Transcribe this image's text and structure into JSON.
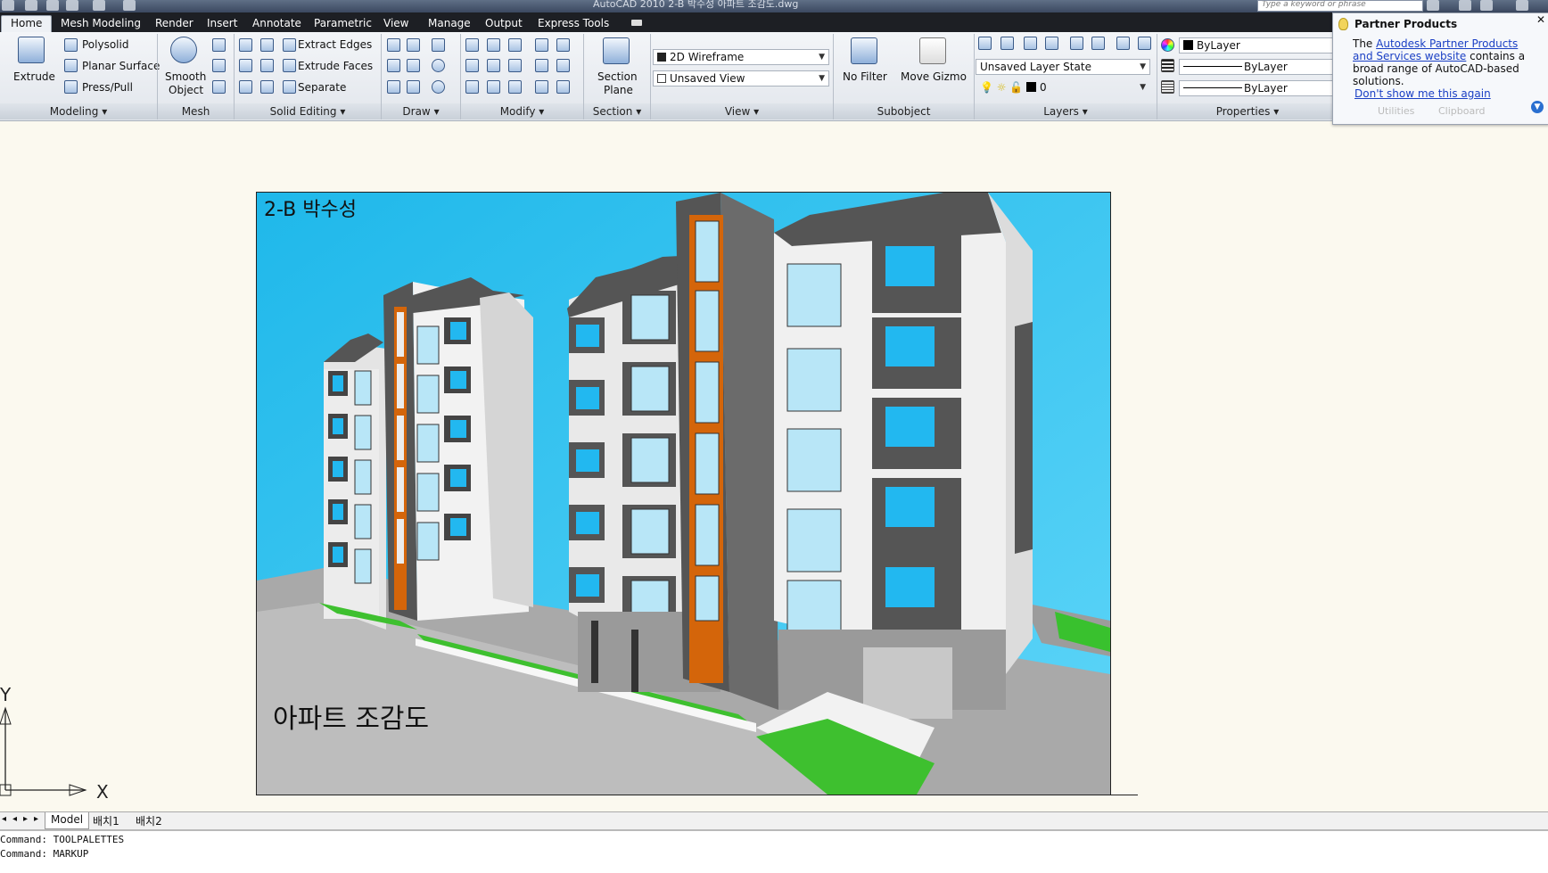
{
  "window": {
    "title": "AutoCAD 2010    2-B 박수성 아파트 조감도.dwg"
  },
  "search": {
    "placeholder": "Type a keyword or phrase"
  },
  "tabs": [
    "Home",
    "Mesh Modeling",
    "Render",
    "Insert",
    "Annotate",
    "Parametric",
    "View",
    "Manage",
    "Output",
    "Express Tools"
  ],
  "panels": {
    "modeling": {
      "title": "Modeling",
      "extrude": "Extrude",
      "polysolid": "Polysolid",
      "planar_surface": "Planar Surface",
      "press_pull": "Press/Pull"
    },
    "mesh": {
      "title": "Mesh",
      "smooth_object_1": "Smooth",
      "smooth_object_2": "Object"
    },
    "solid_editing": {
      "title": "Solid Editing",
      "extract_edges": "Extract Edges",
      "extrude_faces": "Extrude Faces",
      "separate": "Separate"
    },
    "draw": {
      "title": "Draw"
    },
    "modify": {
      "title": "Modify"
    },
    "section": {
      "title": "Section",
      "section_plane_1": "Section",
      "section_plane_2": "Plane"
    },
    "view": {
      "title": "View",
      "visual_style": "2D Wireframe",
      "named_view": "Unsaved View"
    },
    "subobject": {
      "title": "Subobject",
      "no_filter": "No Filter",
      "move_gizmo": "Move Gizmo"
    },
    "layers": {
      "title": "Layers",
      "layer_state": "Unsaved Layer State",
      "current_layer": "0"
    },
    "properties": {
      "title": "Properties",
      "color": "ByLayer",
      "linetype": "ByLayer",
      "lineweight": "ByLayer"
    },
    "hidden": {
      "utilities": "Utilities",
      "clipboard": "Clipboard"
    }
  },
  "partner_popup": {
    "title": "Partner Products",
    "text_prefix": "The ",
    "link": "Autodesk Partner Products and Services website",
    "text_suffix": " contains a broad range of AutoCAD-based solutions.",
    "dismiss": "Don't show me this again"
  },
  "drawing": {
    "label_top": "2-B 박수성",
    "label_bottom": "아파트 조감도"
  },
  "ucs": {
    "x": "X",
    "y": "Y"
  },
  "layout_tabs": [
    "Model",
    "배치1",
    "배치2"
  ],
  "command_history": [
    "Command: TOOLPALETTES",
    "Command: MARKUP"
  ],
  "colors": {
    "accent_tab": "#1d1f24",
    "stair_orange": "#d4650a",
    "sky": "#2fc4f2",
    "window_blue": "#22b8f0"
  }
}
